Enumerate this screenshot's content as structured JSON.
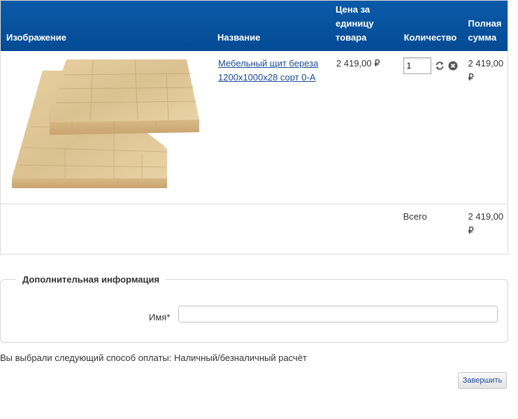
{
  "cart": {
    "headers": {
      "image": "Изображение",
      "name": "Название",
      "unit_price": "Цена за единицу товара",
      "quantity": "Количество",
      "total": "Полная сумма"
    },
    "item": {
      "image_name": "birch-furniture-board-image",
      "name": "Мебельный щит береза 1200х1000х28 сорт 0-А",
      "unit_price": "2 419,00 ₽",
      "quantity": "1",
      "sum": "2 419,00 ₽"
    },
    "total_label": "Всего",
    "total_value": "2 419,00 ₽"
  },
  "info": {
    "legend": "Дополнительная информация",
    "name_label": "Имя*",
    "name_value": ""
  },
  "payment_text": "Вы выбрали следующий способ оплаты: Наличный/безналичный расчёт",
  "finish_label": "Завершить",
  "colors": {
    "header_bg": "#034a94",
    "link": "#1a4a9a",
    "border": "#dcdcdc"
  }
}
